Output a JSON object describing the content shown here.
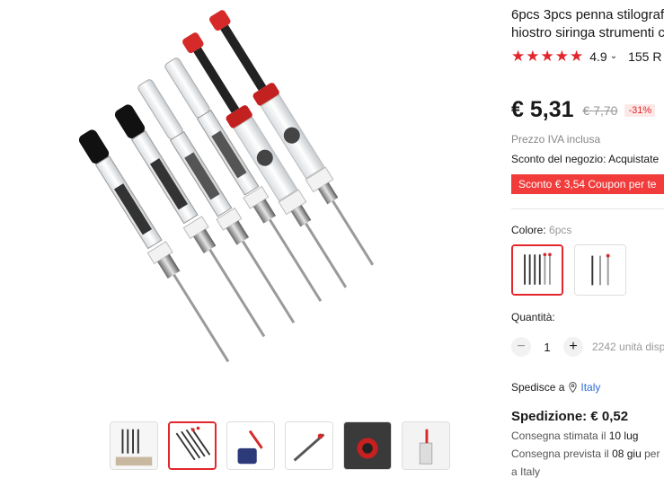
{
  "product": {
    "title_line1": "6pcs 3pcs penna stilografi",
    "title_line2": "hiostro siringa strumenti c"
  },
  "rating": {
    "value": "4.9",
    "chevron": "⌄",
    "reviews_text": "155 R",
    "stars": 5,
    "star_color": "#e3262b"
  },
  "price": {
    "current": "€ 5,31",
    "original": "€ 7,70",
    "discount": "-31%",
    "vat_note": "Prezzo IVA inclusa",
    "shop_discount": "Sconto del negozio: Acquistate",
    "coupon_banner": "Sconto € 3,54 Coupon per te"
  },
  "variant": {
    "label": "Colore:",
    "selected": "6pcs"
  },
  "quantity": {
    "label": "Quantità:",
    "minus": "−",
    "value": "1",
    "plus": "+",
    "stock": "2242 unità disp"
  },
  "shipping": {
    "ship_to_label": "Spedisce a",
    "country": "Italy",
    "cost": "Spedizione: € 0,52",
    "estimated_prefix": "Consegna stimata il",
    "estimated_date": "10 lug",
    "expected_prefix": "Consegna prevista il",
    "expected_date": "08 giu",
    "expected_suffix": "per",
    "expected_line2": "a Italy"
  },
  "colors": {
    "accent": "#e3262b",
    "coupon_bg": "#f23b3b",
    "link": "#2e6bd6"
  }
}
